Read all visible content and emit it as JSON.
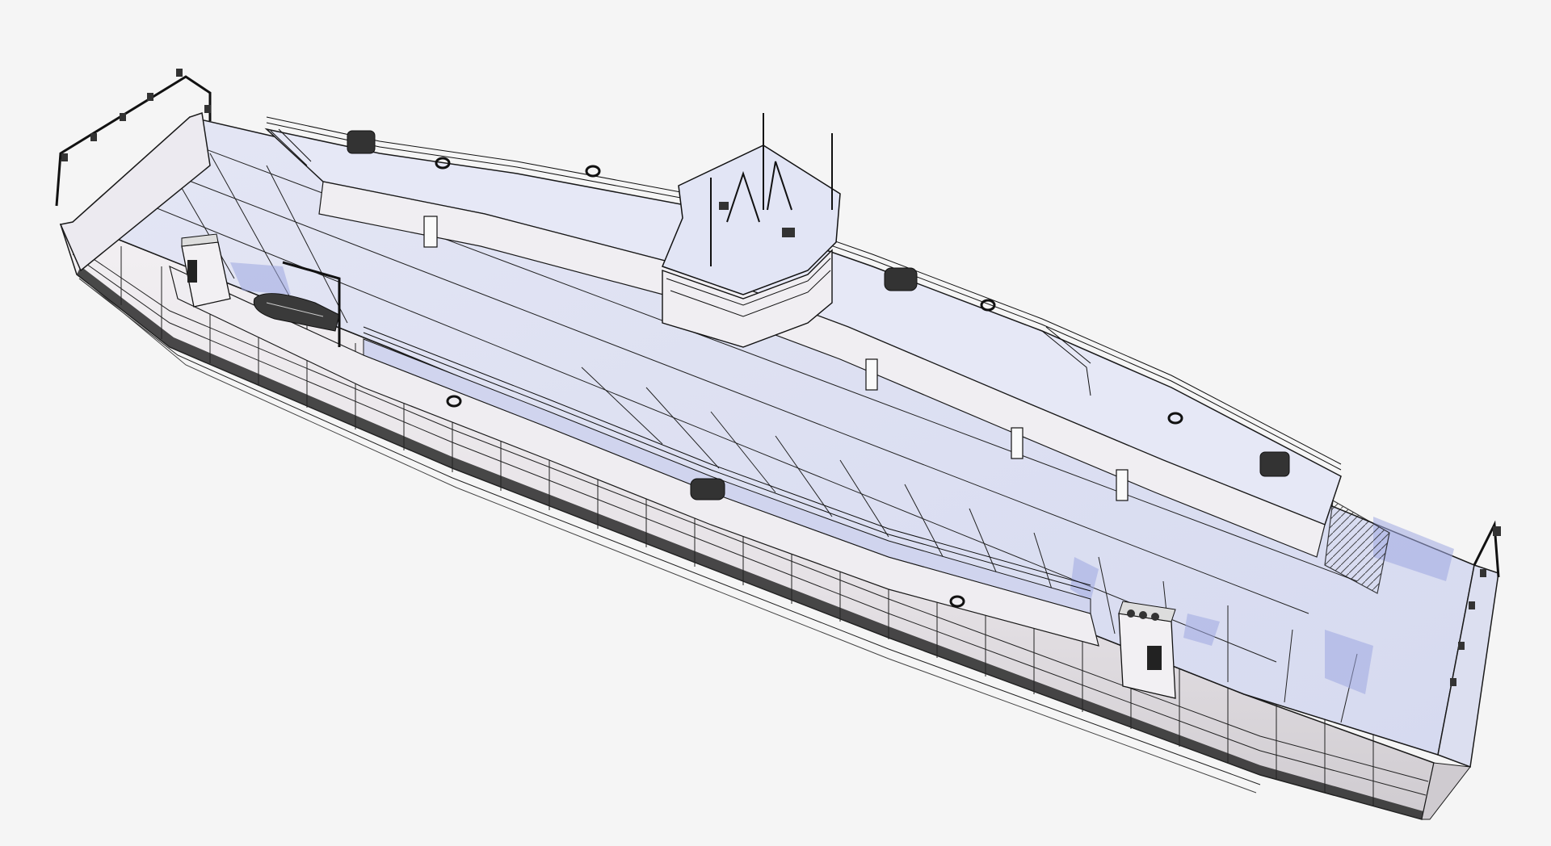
{
  "scene": {
    "subject": "wireframe-ferry-render",
    "view": "isometric-top",
    "colors": {
      "background": "#f5f5f5",
      "deck": "#dfe2f3",
      "deck_shadow": "#9fa8e0",
      "hull_side": "#ece8ec",
      "wire": "#1a1a1a",
      "hull_bottom": "#232323"
    }
  }
}
